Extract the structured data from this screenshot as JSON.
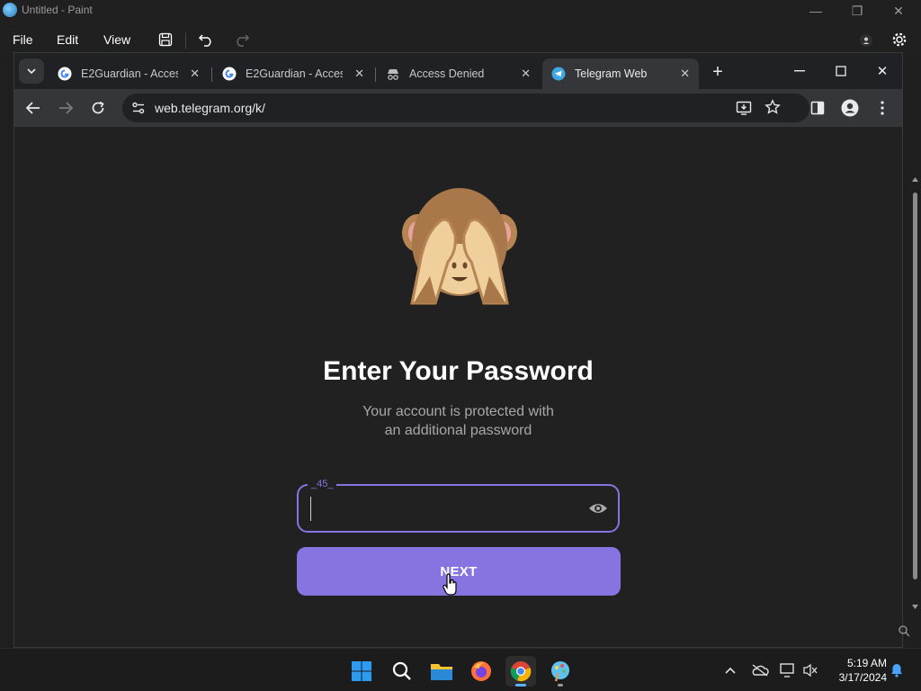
{
  "paint": {
    "title": "Untitled - Paint",
    "menu": [
      "File",
      "Edit",
      "View"
    ]
  },
  "browser": {
    "tabs": [
      {
        "label": "E2Guardian - Access",
        "icon": "google-g-icon"
      },
      {
        "label": "E2Guardian - Access",
        "icon": "google-g-icon"
      },
      {
        "label": "Access Denied",
        "icon": "incognito-icon"
      },
      {
        "label": "Telegram Web",
        "icon": "telegram-icon",
        "active": true
      }
    ],
    "url": "web.telegram.org/k/"
  },
  "page": {
    "heading": "Enter Your Password",
    "subtitle_line1": "Your account is protected with",
    "subtitle_line2": "an additional password",
    "password_label": "_45_",
    "password_value": "",
    "next_label": "NEXT"
  },
  "taskbar": {
    "time": "5:19 AM",
    "date": "3/17/2024"
  },
  "colors": {
    "accent": "#8774e1",
    "background": "#212121"
  }
}
